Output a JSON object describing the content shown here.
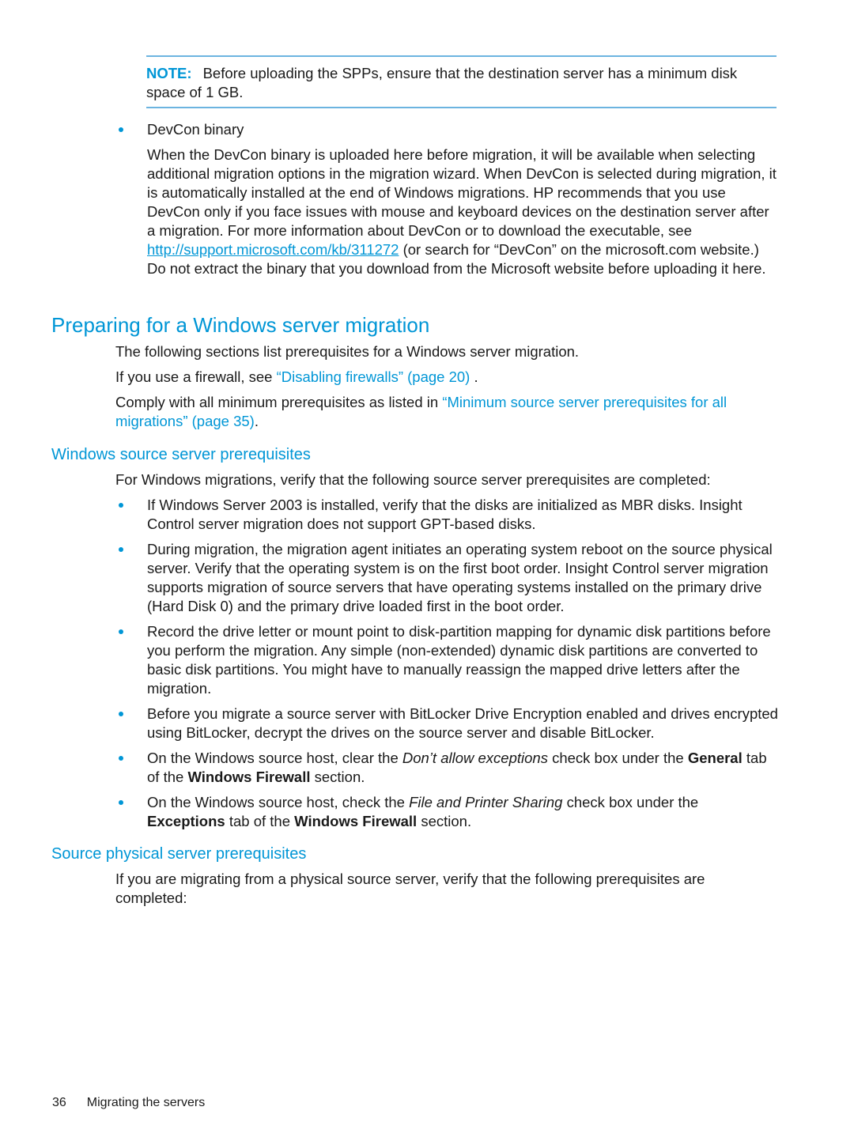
{
  "note": {
    "label": "NOTE:",
    "text": "Before uploading the SPPs, ensure that the destination server has a minimum disk space of 1 GB."
  },
  "devcon": {
    "bullet_title": "DevCon binary",
    "text_1": "When the DevCon binary is uploaded here before migration, it will be available when selecting additional migration options in the migration wizard. When DevCon is selected during migration, it is automatically installed at the end of Windows migrations. HP recommends that you use DevCon only if you face issues with mouse and keyboard devices on the destination server after a migration. For more information about DevCon or to download the executable, see ",
    "link": "http://support.microsoft.com/kb/311272",
    "text_2": " (or search for “DevCon” on the microsoft.com website.) Do not extract the binary that you download from the Microsoft website before uploading it here."
  },
  "section": {
    "title": "Preparing for a Windows server migration",
    "intro": "The following sections list prerequisites for a Windows server migration.",
    "firewall_prefix": "If you use a firewall, see ",
    "firewall_link": "“Disabling firewalls” (page 20)",
    "firewall_suffix": " .",
    "comply_prefix": "Comply with all minimum prerequisites as listed in ",
    "comply_link": "“Minimum source server prerequisites for all migrations” (page 35)",
    "comply_suffix": "."
  },
  "windows_prereqs": {
    "heading": "Windows source server prerequisites",
    "intro": "For Windows migrations, verify that the following source server prerequisites are completed:",
    "items": [
      "If Windows Server 2003 is installed, verify that the disks are initialized as MBR disks. Insight Control server migration does not support GPT-based disks.",
      "During migration, the migration agent initiates an operating system reboot on the source physical server. Verify that the operating system is on the first boot order. Insight Control server migration supports migration of source servers that have operating systems installed on the primary drive (Hard Disk 0) and the primary drive loaded first in the boot order.",
      "Record the drive letter or mount point to disk-partition mapping for dynamic disk partitions before you perform the migration. Any simple (non-extended) dynamic disk partitions are converted to basic disk partitions. You might have to manually reassign the mapped drive letters after the migration.",
      "Before you migrate a source server with BitLocker Drive Encryption enabled and drives encrypted using BitLocker, decrypt the drives on the source server and disable BitLocker."
    ],
    "item5": {
      "t1": "On the Windows source host, clear the ",
      "em": "Don’t allow exceptions",
      "t2": " check box under the ",
      "b1": "General",
      "t3": " tab of the ",
      "b2": "Windows Firewall",
      "t4": " section."
    },
    "item6": {
      "t1": "On the Windows source host, check the ",
      "em": "File and Printer Sharing",
      "t2": " check box under the ",
      "b1": "Exceptions",
      "t3": " tab of the ",
      "b2": "Windows Firewall",
      "t4": " section."
    }
  },
  "physical_prereqs": {
    "heading": "Source physical server prerequisites",
    "intro": "If you are migrating from a physical source server, verify that the following prerequisites are completed:"
  },
  "footer": {
    "page_number": "36",
    "chapter": "Migrating the servers"
  }
}
